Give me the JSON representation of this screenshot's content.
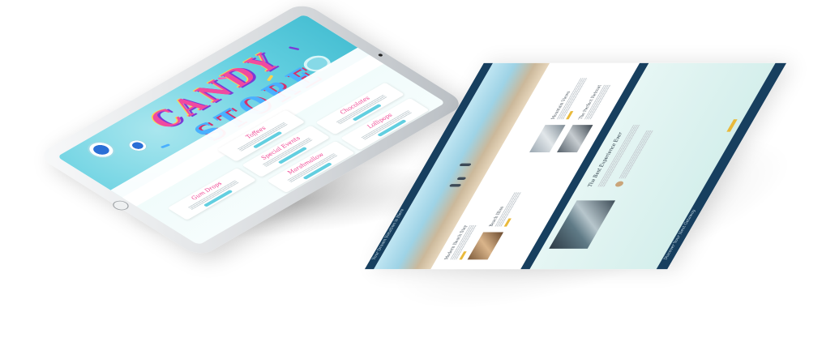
{
  "tablet": {
    "hero": {
      "title_line1": "CANDY",
      "title_line2": "STORE"
    },
    "cards": [
      {
        "title": "Toffees"
      },
      {
        "title": "Special Events"
      },
      {
        "title": "Chocolates"
      },
      {
        "title": "Gum Drops"
      },
      {
        "title": "Marshmallow"
      },
      {
        "title": "Lollipops"
      }
    ]
  },
  "page": {
    "top_banner": "Your Dream Vacation is Here",
    "sections": [
      {
        "title": "Modern Beach Stay"
      },
      {
        "title": "Beach Bliss"
      },
      {
        "title": "Mountain Views"
      },
      {
        "title": "The Perfect Retreat"
      }
    ],
    "experience_title": "The Best Experience Ever",
    "bottom_banner": "Discover Your Next Getaway"
  },
  "colors": {
    "candy_pink": "#f04aa0",
    "candy_teal": "#62cfe0",
    "navy": "#173f5f",
    "gold": "#e9b93a",
    "mint": "#d5efec"
  }
}
